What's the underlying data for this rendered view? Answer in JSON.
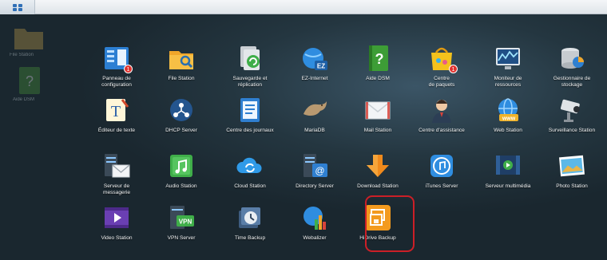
{
  "taskbar": {
    "menu_icon": "grid-menu-icon"
  },
  "desktop": {
    "shortcuts": [
      {
        "label": "File Station",
        "icon": "folder-icon"
      },
      {
        "label": "Aide DSM",
        "icon": "help-book-icon"
      }
    ]
  },
  "apps": [
    {
      "label": "Panneau de\nconfiguration",
      "icon": "control-panel-icon",
      "badge": "1"
    },
    {
      "label": "File Station",
      "icon": "folder-search-icon"
    },
    {
      "label": "Sauvegarde et\nréplication",
      "icon": "backup-replication-icon"
    },
    {
      "label": "EZ-Internet",
      "icon": "ez-internet-icon"
    },
    {
      "label": "Aide DSM",
      "icon": "help-book-icon"
    },
    {
      "label": "Centre\nde paquets",
      "icon": "package-center-icon",
      "badge": "1"
    },
    {
      "label": "Moniteur de\nressources",
      "icon": "resource-monitor-icon"
    },
    {
      "label": "Gestionnaire de\nstockage",
      "icon": "storage-manager-icon"
    },
    {
      "label": "Éditeur de texte",
      "icon": "text-editor-icon"
    },
    {
      "label": "DHCP Server",
      "icon": "dhcp-server-icon"
    },
    {
      "label": "Centre des journaux",
      "icon": "log-center-icon"
    },
    {
      "label": "MariaDB",
      "icon": "mariadb-seal-icon"
    },
    {
      "label": "Mail Station",
      "icon": "mail-envelope-icon"
    },
    {
      "label": "Centre d'assistance",
      "icon": "support-agent-icon"
    },
    {
      "label": "Web Station",
      "icon": "web-station-icon"
    },
    {
      "label": "Surveillance Station",
      "icon": "surveillance-camera-icon"
    },
    {
      "label": "Serveur de\nmessagerie",
      "icon": "mail-server-icon"
    },
    {
      "label": "Audio Station",
      "icon": "audio-station-icon"
    },
    {
      "label": "Cloud Station",
      "icon": "cloud-sync-icon"
    },
    {
      "label": "Directory Server",
      "icon": "directory-server-icon"
    },
    {
      "label": "Download Station",
      "icon": "download-arrow-icon"
    },
    {
      "label": "iTunes Server",
      "icon": "itunes-icon"
    },
    {
      "label": "Serveur multimédia",
      "icon": "media-server-icon"
    },
    {
      "label": "Photo Station",
      "icon": "photo-station-icon"
    },
    {
      "label": "Video Station",
      "icon": "video-station-icon"
    },
    {
      "label": "VPN Server",
      "icon": "vpn-server-icon"
    },
    {
      "label": "Time Backup",
      "icon": "time-backup-icon"
    },
    {
      "label": "Webalizer",
      "icon": "webalizer-icon"
    },
    {
      "label": "HiDrive Backup",
      "icon": "hidrive-backup-icon"
    }
  ],
  "highlighted_app": "HiDrive Backup",
  "colors": {
    "highlight": "#cc1f27",
    "badge": "#e0332f"
  }
}
